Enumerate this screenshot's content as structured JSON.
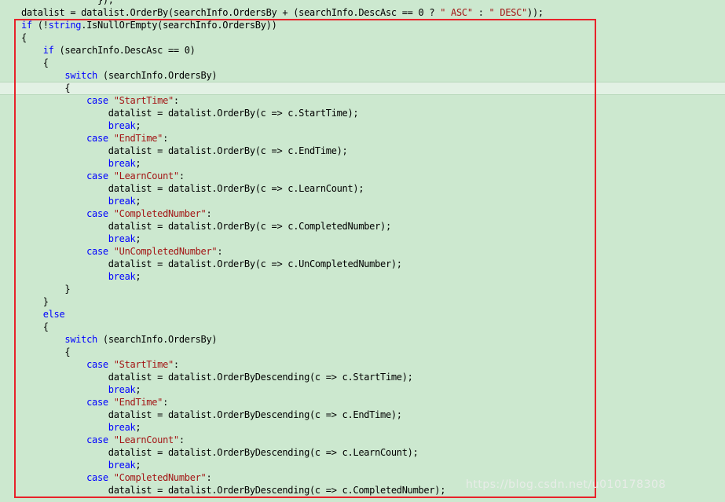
{
  "colors": {
    "background": "#cce8cf",
    "keyword": "#0000ff",
    "string": "#a31515",
    "selection_border": "#e8222a"
  },
  "code_lines": [
    [
      {
        "t": "              });",
        "c": ""
      }
    ],
    [
      {
        "t": "datalist = datalist.OrderBy(searchInfo.OrdersBy + (searchInfo.DescAsc == 0 ? ",
        "c": ""
      },
      {
        "t": "\" ASC\"",
        "c": "str"
      },
      {
        "t": " : ",
        "c": ""
      },
      {
        "t": "\" DESC\"",
        "c": "str"
      },
      {
        "t": "));",
        "c": ""
      }
    ],
    [
      {
        "t": "if",
        "c": "kw"
      },
      {
        "t": " (!",
        "c": ""
      },
      {
        "t": "string",
        "c": "kw"
      },
      {
        "t": ".IsNullOrEmpty(searchInfo.OrdersBy))",
        "c": ""
      }
    ],
    [
      {
        "t": "{",
        "c": ""
      }
    ],
    [
      {
        "t": "    ",
        "c": ""
      },
      {
        "t": "if",
        "c": "kw"
      },
      {
        "t": " (searchInfo.DescAsc == 0)",
        "c": ""
      }
    ],
    [
      {
        "t": "    {",
        "c": ""
      }
    ],
    [
      {
        "t": "        ",
        "c": ""
      },
      {
        "t": "switch",
        "c": "kw"
      },
      {
        "t": " (searchInfo.OrdersBy)",
        "c": ""
      }
    ],
    [
      {
        "t": "        {",
        "c": ""
      }
    ],
    [
      {
        "t": "            ",
        "c": ""
      },
      {
        "t": "case",
        "c": "kw"
      },
      {
        "t": " ",
        "c": ""
      },
      {
        "t": "\"StartTime\"",
        "c": "str"
      },
      {
        "t": ":",
        "c": ""
      }
    ],
    [
      {
        "t": "                datalist = datalist.OrderBy(c => c.StartTime);",
        "c": ""
      }
    ],
    [
      {
        "t": "                ",
        "c": ""
      },
      {
        "t": "break",
        "c": "kw"
      },
      {
        "t": ";",
        "c": ""
      }
    ],
    [
      {
        "t": "            ",
        "c": ""
      },
      {
        "t": "case",
        "c": "kw"
      },
      {
        "t": " ",
        "c": ""
      },
      {
        "t": "\"EndTime\"",
        "c": "str"
      },
      {
        "t": ":",
        "c": ""
      }
    ],
    [
      {
        "t": "                datalist = datalist.OrderBy(c => c.EndTime);",
        "c": ""
      }
    ],
    [
      {
        "t": "                ",
        "c": ""
      },
      {
        "t": "break",
        "c": "kw"
      },
      {
        "t": ";",
        "c": ""
      }
    ],
    [
      {
        "t": "            ",
        "c": ""
      },
      {
        "t": "case",
        "c": "kw"
      },
      {
        "t": " ",
        "c": ""
      },
      {
        "t": "\"LearnCount\"",
        "c": "str"
      },
      {
        "t": ":",
        "c": ""
      }
    ],
    [
      {
        "t": "                datalist = datalist.OrderBy(c => c.LearnCount);",
        "c": ""
      }
    ],
    [
      {
        "t": "                ",
        "c": ""
      },
      {
        "t": "break",
        "c": "kw"
      },
      {
        "t": ";",
        "c": ""
      }
    ],
    [
      {
        "t": "            ",
        "c": ""
      },
      {
        "t": "case",
        "c": "kw"
      },
      {
        "t": " ",
        "c": ""
      },
      {
        "t": "\"CompletedNumber\"",
        "c": "str"
      },
      {
        "t": ":",
        "c": ""
      }
    ],
    [
      {
        "t": "                datalist = datalist.OrderBy(c => c.CompletedNumber);",
        "c": ""
      }
    ],
    [
      {
        "t": "                ",
        "c": ""
      },
      {
        "t": "break",
        "c": "kw"
      },
      {
        "t": ";",
        "c": ""
      }
    ],
    [
      {
        "t": "            ",
        "c": ""
      },
      {
        "t": "case",
        "c": "kw"
      },
      {
        "t": " ",
        "c": ""
      },
      {
        "t": "\"UnCompletedNumber\"",
        "c": "str"
      },
      {
        "t": ":",
        "c": ""
      }
    ],
    [
      {
        "t": "                datalist = datalist.OrderBy(c => c.UnCompletedNumber);",
        "c": ""
      }
    ],
    [
      {
        "t": "                ",
        "c": ""
      },
      {
        "t": "break",
        "c": "kw"
      },
      {
        "t": ";",
        "c": ""
      }
    ],
    [
      {
        "t": "        }",
        "c": ""
      }
    ],
    [
      {
        "t": "    }",
        "c": ""
      }
    ],
    [
      {
        "t": "    ",
        "c": ""
      },
      {
        "t": "else",
        "c": "kw"
      }
    ],
    [
      {
        "t": "    {",
        "c": ""
      }
    ],
    [
      {
        "t": "        ",
        "c": ""
      },
      {
        "t": "switch",
        "c": "kw"
      },
      {
        "t": " (searchInfo.OrdersBy)",
        "c": ""
      }
    ],
    [
      {
        "t": "        {",
        "c": ""
      }
    ],
    [
      {
        "t": "            ",
        "c": ""
      },
      {
        "t": "case",
        "c": "kw"
      },
      {
        "t": " ",
        "c": ""
      },
      {
        "t": "\"StartTime\"",
        "c": "str"
      },
      {
        "t": ":",
        "c": ""
      }
    ],
    [
      {
        "t": "                datalist = datalist.OrderByDescending(c => c.StartTime);",
        "c": ""
      }
    ],
    [
      {
        "t": "                ",
        "c": ""
      },
      {
        "t": "break",
        "c": "kw"
      },
      {
        "t": ";",
        "c": ""
      }
    ],
    [
      {
        "t": "            ",
        "c": ""
      },
      {
        "t": "case",
        "c": "kw"
      },
      {
        "t": " ",
        "c": ""
      },
      {
        "t": "\"EndTime\"",
        "c": "str"
      },
      {
        "t": ":",
        "c": ""
      }
    ],
    [
      {
        "t": "                datalist = datalist.OrderByDescending(c => c.EndTime);",
        "c": ""
      }
    ],
    [
      {
        "t": "                ",
        "c": ""
      },
      {
        "t": "break",
        "c": "kw"
      },
      {
        "t": ";",
        "c": ""
      }
    ],
    [
      {
        "t": "            ",
        "c": ""
      },
      {
        "t": "case",
        "c": "kw"
      },
      {
        "t": " ",
        "c": ""
      },
      {
        "t": "\"LearnCount\"",
        "c": "str"
      },
      {
        "t": ":",
        "c": ""
      }
    ],
    [
      {
        "t": "                datalist = datalist.OrderByDescending(c => c.LearnCount);",
        "c": ""
      }
    ],
    [
      {
        "t": "                ",
        "c": ""
      },
      {
        "t": "break",
        "c": "kw"
      },
      {
        "t": ";",
        "c": ""
      }
    ],
    [
      {
        "t": "            ",
        "c": ""
      },
      {
        "t": "case",
        "c": "kw"
      },
      {
        "t": " ",
        "c": ""
      },
      {
        "t": "\"CompletedNumber\"",
        "c": "str"
      },
      {
        "t": ":",
        "c": ""
      }
    ],
    [
      {
        "t": "                datalist = datalist.OrderByDescending(c => c.CompletedNumber);",
        "c": ""
      }
    ]
  ],
  "watermark": "https://blog.csdn.net/u010178308"
}
